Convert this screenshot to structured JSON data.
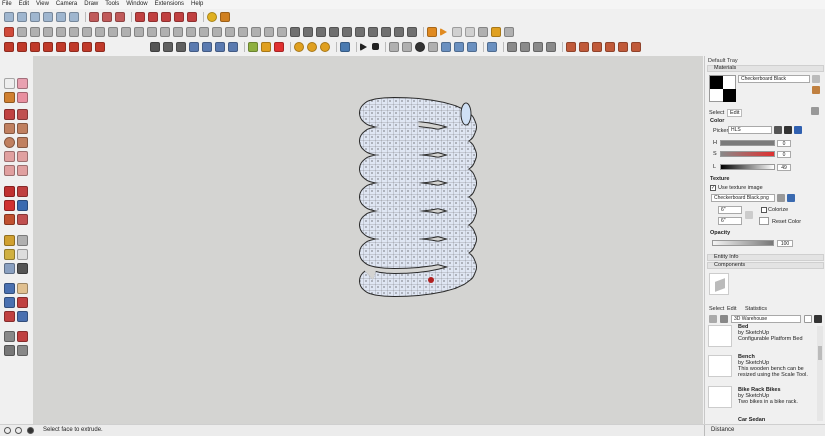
{
  "menu": [
    "File",
    "Edit",
    "View",
    "Camera",
    "Draw",
    "Tools",
    "Window",
    "Extensions",
    "Help"
  ],
  "tray": {
    "title": "Default Tray",
    "materials": {
      "section": "Materials",
      "material_name": "Checkerboard Black",
      "tabs": [
        "Select",
        "Edit"
      ],
      "color_label": "Color",
      "picker_label": "Picker:",
      "picker_value": "HLS",
      "h_label": "H",
      "s_label": "S",
      "l_label": "L",
      "h_value": "0",
      "s_value": "0",
      "l_value": "49",
      "texture_label": "Texture",
      "use_texture_label": "Use texture image",
      "texture_file": "Checkerboard Black.png",
      "width_value": "6\"",
      "height_value": "6\"",
      "colorize_label": "Colorize",
      "reset_color_label": "Reset Color",
      "opacity_label": "Opacity",
      "opacity_value": "100"
    },
    "entity_info": "Entity Info",
    "components": {
      "section": "Components",
      "tabs": [
        "Select",
        "Edit",
        "Statistics"
      ],
      "search_placeholder": "3D Warehouse",
      "items": [
        {
          "name": "Bed",
          "author": "by SketchUp",
          "desc": "Configurable Platform Bed"
        },
        {
          "name": "Bench",
          "author": "by SketchUp",
          "desc": "This wooden bench can be resized using the Scale Tool."
        },
        {
          "name": "Bike Rack Bikes",
          "author": "by SketchUp",
          "desc": "Two bikes in a bike rack."
        },
        {
          "name": "Car Sedan",
          "author": "",
          "desc": ""
        }
      ]
    }
  },
  "status": {
    "message": "Select face to extrude.",
    "measurements_label": "Distance"
  },
  "colors": {
    "viewport_bg": "#d4d4d2",
    "coil_fill": "#dfe6f3",
    "coil_edge": "#2a2a2a",
    "lightness_bar": "#7a7a7a",
    "saturation_bar": "#e03030"
  }
}
